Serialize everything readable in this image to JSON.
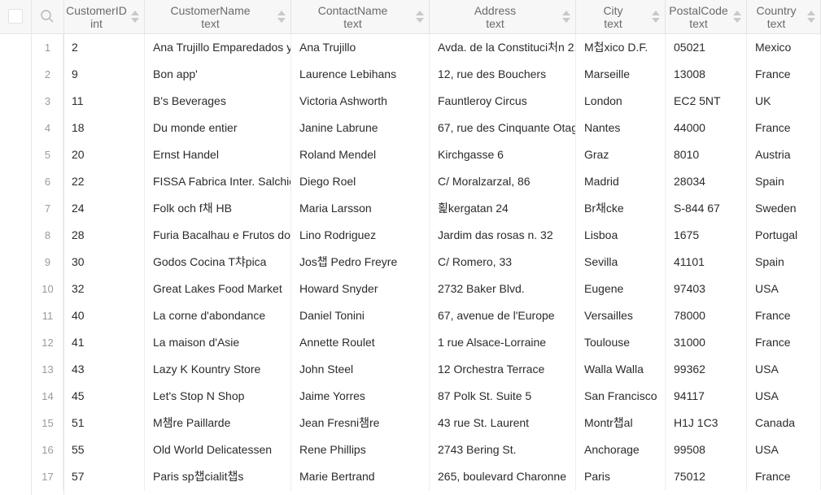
{
  "columns": [
    {
      "name": "CustomerID",
      "type": "int"
    },
    {
      "name": "CustomerName",
      "type": "text"
    },
    {
      "name": "ContactName",
      "type": "text"
    },
    {
      "name": "Address",
      "type": "text"
    },
    {
      "name": "City",
      "type": "text"
    },
    {
      "name": "PostalCode",
      "type": "text"
    },
    {
      "name": "Country",
      "type": "text"
    }
  ],
  "rows": [
    [
      "1",
      "2",
      "Ana Trujillo Emparedados y",
      "Ana Trujillo",
      "Avda. de la Constituci처n 2.",
      "M첩xico D.F.",
      "05021",
      "Mexico"
    ],
    [
      "2",
      "9",
      "Bon app'",
      "Laurence Lebihans",
      "12, rue des Bouchers",
      "Marseille",
      "13008",
      "France"
    ],
    [
      "3",
      "11",
      "B's Beverages",
      "Victoria Ashworth",
      "Fauntleroy Circus",
      "London",
      "EC2 5NT",
      "UK"
    ],
    [
      "4",
      "18",
      "Du monde entier",
      "Janine Labrune",
      "67, rue des Cinquante Otag",
      "Nantes",
      "44000",
      "France"
    ],
    [
      "5",
      "20",
      "Ernst Handel",
      "Roland Mendel",
      "Kirchgasse 6",
      "Graz",
      "8010",
      "Austria"
    ],
    [
      "6",
      "22",
      "FISSA Fabrica Inter. Salchich",
      "Diego Roel",
      "C/ Moralzarzal, 86",
      "Madrid",
      "28034",
      "Spain"
    ],
    [
      "7",
      "24",
      "Folk och f채 HB",
      "Maria Larsson",
      "횙kergatan 24",
      "Br채cke",
      "S-844 67",
      "Sweden"
    ],
    [
      "8",
      "28",
      "Furia Bacalhau e Frutos do",
      "Lino Rodriguez",
      "Jardim das rosas n. 32",
      "Lisboa",
      "1675",
      "Portugal"
    ],
    [
      "9",
      "30",
      "Godos Cocina T챠pica",
      "Jos챕 Pedro Freyre",
      "C/ Romero, 33",
      "Sevilla",
      "41101",
      "Spain"
    ],
    [
      "10",
      "32",
      "Great Lakes Food Market",
      "Howard Snyder",
      "2732 Baker Blvd.",
      "Eugene",
      "97403",
      "USA"
    ],
    [
      "11",
      "40",
      "La corne d'abondance",
      "Daniel Tonini",
      "67, avenue de l'Europe",
      "Versailles",
      "78000",
      "France"
    ],
    [
      "12",
      "41",
      "La maison d'Asie",
      "Annette Roulet",
      "1 rue Alsace-Lorraine",
      "Toulouse",
      "31000",
      "France"
    ],
    [
      "13",
      "43",
      "Lazy K Kountry Store",
      "John Steel",
      "12 Orchestra Terrace",
      "Walla Walla",
      "99362",
      "USA"
    ],
    [
      "14",
      "45",
      "Let's Stop N Shop",
      "Jaime Yorres",
      "87 Polk St. Suite 5",
      "San Francisco",
      "94117",
      "USA"
    ],
    [
      "15",
      "51",
      "M챔re Paillarde",
      "Jean Fresni챔re",
      "43 rue St. Laurent",
      "Montr챕al",
      "H1J 1C3",
      "Canada"
    ],
    [
      "16",
      "55",
      "Old World Delicatessen",
      "Rene Phillips",
      "2743 Bering St.",
      "Anchorage",
      "99508",
      "USA"
    ],
    [
      "17",
      "57",
      "Paris sp챕cialit챕s",
      "Marie Bertrand",
      "265, boulevard Charonne",
      "Paris",
      "75012",
      "France"
    ]
  ]
}
